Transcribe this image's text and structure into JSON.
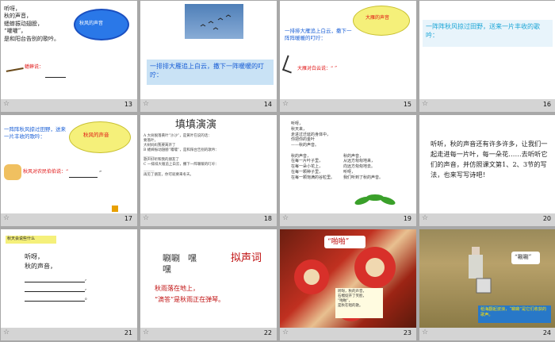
{
  "slides": [
    {
      "num": "13",
      "lines": [
        "听呀，",
        "秋的声音，",
        "蟋蟀振动翅膀，",
        "“嚯嚯”，",
        "是和阳台告别的歌吟。"
      ],
      "cloud": "秋风的声音",
      "bottom_label": "蟋蟀说："
    },
    {
      "num": "14",
      "caption": "一排排大雁追上白云，撒下一阵暖暖的叮咛："
    },
    {
      "num": "15",
      "header": "一排排大雁追上白云，撒下一阵阵暖暖的叮咛：",
      "cloud": "大雁的声音",
      "bottom_label": "大雁对白云说：“ ”"
    },
    {
      "num": "16",
      "header": "一阵阵秋风掠过田野，送来一片丰收的歌吟："
    },
    {
      "num": "17",
      "header": "一阵阵秋风掠过田野，送来一片丰收的歌吟：",
      "cloud": "秋风的声音",
      "bottom_label": "秋风对农民伯伯说：“",
      "quote_end": "”"
    },
    {
      "num": "18",
      "title": "填填演演",
      "lines": [
        "A 大树脱落黄叶“沙沙”，是黄叶在说的话：",
        "要落叶，______",
        "大树妈妈我要离开了",
        "B 蟋蟀振动翅膀“嚯嚯”，是和阳台告别的歌吟：",
        "______",
        "歌声好听和我的朋友了",
        "C 一排排大雁追上白云，撒下一阵暖暖的叮咛：",
        "______",
        "再见了朋友，你可就要来冬天。"
      ]
    },
    {
      "num": "19",
      "poem_left": [
        "听呀，",
        "秋天来，",
        "走进过迁延的身体中，",
        "你把你的金叶",
        "——秋的声音。",
        "",
        "秋的声音，",
        "在每一片叶子里，",
        "在每一朵小花上，",
        "在每一颗种子里，",
        "在每一颗饱满的谷粒里。"
      ],
      "poem_right": [
        "",
        "",
        "",
        "",
        "",
        "",
        "秋的声音，",
        "从远方匆匆地来，",
        "向远方匆匆地去。",
        "听呀，",
        "我们听到了秋的声音。"
      ]
    },
    {
      "num": "20",
      "text": "听听，秋的声音还有许多许多，让我们一起走进每一片叶，每一朵花……去听听它们的声音，并仿照课文第1、2、3节的写法，也来写写诗吧！"
    },
    {
      "num": "21",
      "tag": "秋天会说些什么",
      "lines": [
        "听呀，",
        "秋的声音，"
      ],
      "commas": [
        ",",
        ",",
        "。"
      ]
    },
    {
      "num": "22",
      "words": [
        "唰唰",
        "嘿",
        "嘿"
      ],
      "title": "拟声词",
      "lines": [
        "秋雨落在地上，",
        "“滴答”是秋雨正在弹琴。"
      ]
    },
    {
      "num": "23",
      "badge": "“啪啪”",
      "note": [
        "听呀，秋的声音，",
        "石榴绽开了笑脸，",
        "“啪啪”，",
        "是秋在唱的歌。"
      ]
    },
    {
      "num": "24",
      "badge": "“唰唰”",
      "caption": "稻海翻起波浪，“唰唰”是它们收获的歌声。"
    }
  ],
  "colors": {
    "blue": "#1a5fd6",
    "red": "#e01010",
    "yellow": "#f5f07a",
    "cyan": "#1aa5d6"
  }
}
